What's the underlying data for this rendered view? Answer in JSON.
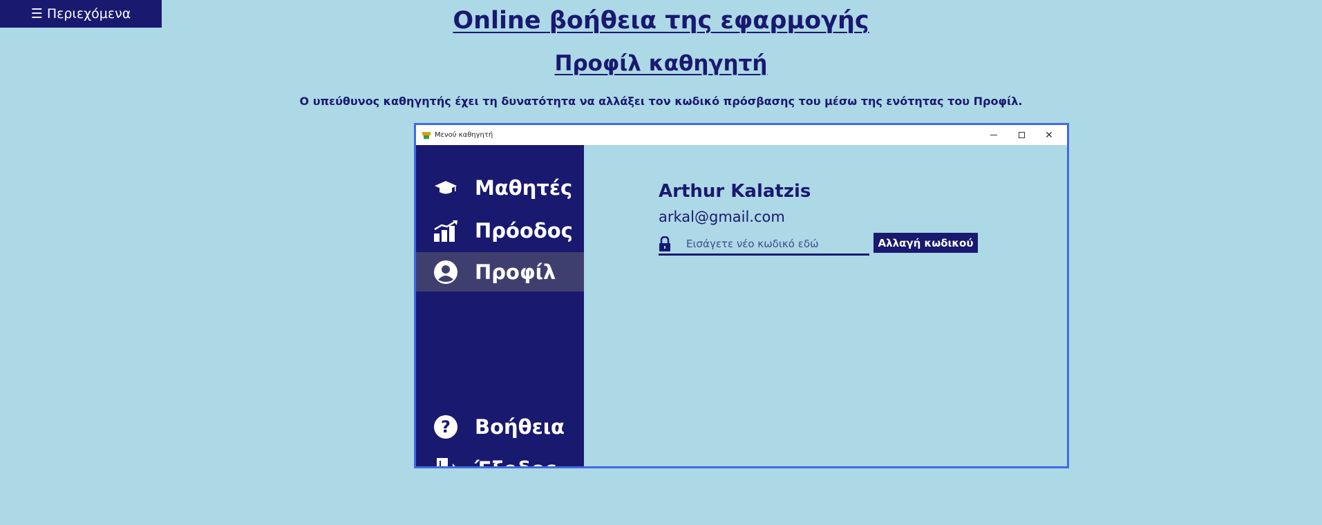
{
  "toc": {
    "glyph": "☰",
    "label": "Περιεχόμενα"
  },
  "page": {
    "title": "Online βοήθεια της εφαρμογής",
    "section_title": "Προφίλ καθηγητή",
    "description": "Ο υπεύθυνος καθηγητής έχει τη δυνατότητα να αλλάξει τον κωδικό πρόσβασης του μέσω της ενότητας του Προφίλ."
  },
  "window": {
    "title": "Μενού καθηγητή",
    "controls": [
      "minimize-icon",
      "maximize-icon",
      "close-icon"
    ],
    "close_glyph": "✕"
  },
  "sidebar": {
    "items": [
      {
        "label": "Μαθητές",
        "icon": "graduation-cap-icon",
        "active": false
      },
      {
        "label": "Πρόοδος",
        "icon": "progress-chart-icon",
        "active": false
      },
      {
        "label": "Προφίλ",
        "icon": "user-circle-icon",
        "active": true
      },
      {
        "label": "Βοήθεια",
        "icon": "help-circle-icon",
        "active": false
      },
      {
        "label": "Έξοδος",
        "icon": "exit-door-icon",
        "active": false
      }
    ]
  },
  "profile": {
    "name": "Arthur Kalatzis",
    "email": "arkal@gmail.com",
    "password_placeholder": "Εισάγετε νέο κωδικό εδώ",
    "change_button_label": "Αλλαγή κωδικού"
  },
  "colors": {
    "page_bg": "#add8e6",
    "navy": "#191970",
    "active_item": "#3f3f6f",
    "figure_border": "#4169e1"
  }
}
